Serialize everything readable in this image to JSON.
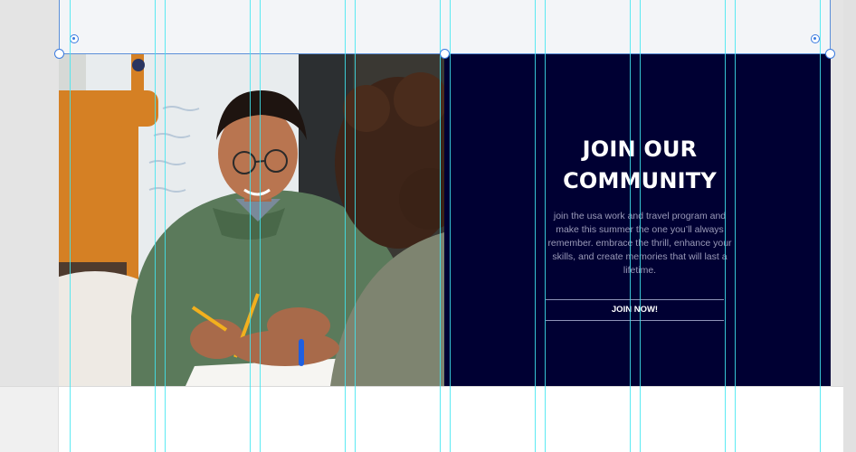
{
  "hero": {
    "heading": "JOIN OUR COMMUNITY",
    "body": "join the usa work and travel program and make this summer the one you’ll always remember. embrace the thrill, enhance your skills, and create memories that will last a lifetime.",
    "button_label": "JOIN NOW!",
    "panel_color": "#000033"
  },
  "editor": {
    "guide_color": "#3fe6f1",
    "selection_color": "#3b7be0"
  },
  "icons": {
    "handle_left": "resize-handle-icon",
    "handle_right": "resize-handle-icon"
  }
}
